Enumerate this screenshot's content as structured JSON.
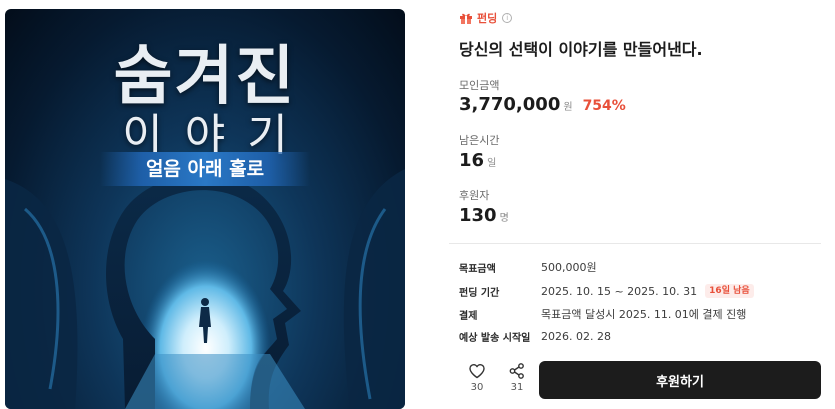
{
  "poster": {
    "title": "숨겨진",
    "subtitle": "이야기",
    "banner": "얼음 아래 홀로"
  },
  "category": {
    "label": "펀딩",
    "icon": "gift-icon",
    "info_icon": "info-icon"
  },
  "headline": "당신의 선택이 이야기를 만들어낸다.",
  "stats": {
    "raised": {
      "label": "모인금액",
      "value": "3,770,000",
      "unit": "원",
      "percent": "754%"
    },
    "remaining": {
      "label": "남은시간",
      "value": "16",
      "unit": "일"
    },
    "backers": {
      "label": "후원자",
      "value": "130",
      "unit": "명"
    }
  },
  "details": [
    {
      "key": "목표금액",
      "value": "500,000원"
    },
    {
      "key": "펀딩 기간",
      "value": "2025. 10. 15 ~ 2025. 10. 31",
      "badge": "16일 남음"
    },
    {
      "key": "결제",
      "value": "목표금액 달성시 2025. 11. 01에 결제 진행"
    },
    {
      "key": "예상 발송 시작일",
      "value": "2026. 02. 28"
    }
  ],
  "actions": {
    "like": {
      "icon": "heart-icon",
      "count": "30"
    },
    "share": {
      "icon": "share-icon",
      "count": "31"
    },
    "support_label": "후원하기"
  },
  "colors": {
    "accent": "#e8503a",
    "button": "#1c1c1c"
  }
}
